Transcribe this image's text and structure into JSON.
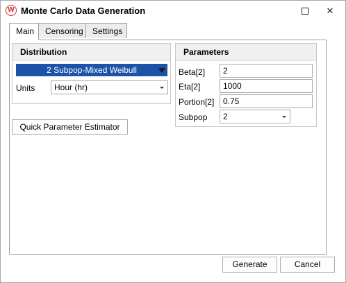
{
  "window": {
    "title": "Monte Carlo Data Generation",
    "app_icon_letter": "W",
    "maximize_icon": "maximize-icon",
    "close_glyph": "✕"
  },
  "tabs": [
    {
      "label": "Main",
      "active": true
    },
    {
      "label": "Censoring",
      "active": false
    },
    {
      "label": "Settings",
      "active": false
    }
  ],
  "distribution": {
    "header": "Distribution",
    "selected": "2 Subpop-Mixed Weibull",
    "units_label": "Units",
    "units_value": "Hour (hr)"
  },
  "parameters": {
    "header": "Parameters",
    "rows": [
      {
        "label": "Beta[2]",
        "value": "2"
      },
      {
        "label": "Eta[2]",
        "value": "1000"
      },
      {
        "label": "Portion[2]",
        "value": "0.75"
      }
    ],
    "subpop_label": "Subpop",
    "subpop_value": "2"
  },
  "buttons": {
    "estimator": "Quick Parameter Estimator",
    "generate": "Generate",
    "cancel": "Cancel"
  },
  "colors": {
    "selection": "#1c52a8",
    "logo_red": "#d42a2a"
  }
}
